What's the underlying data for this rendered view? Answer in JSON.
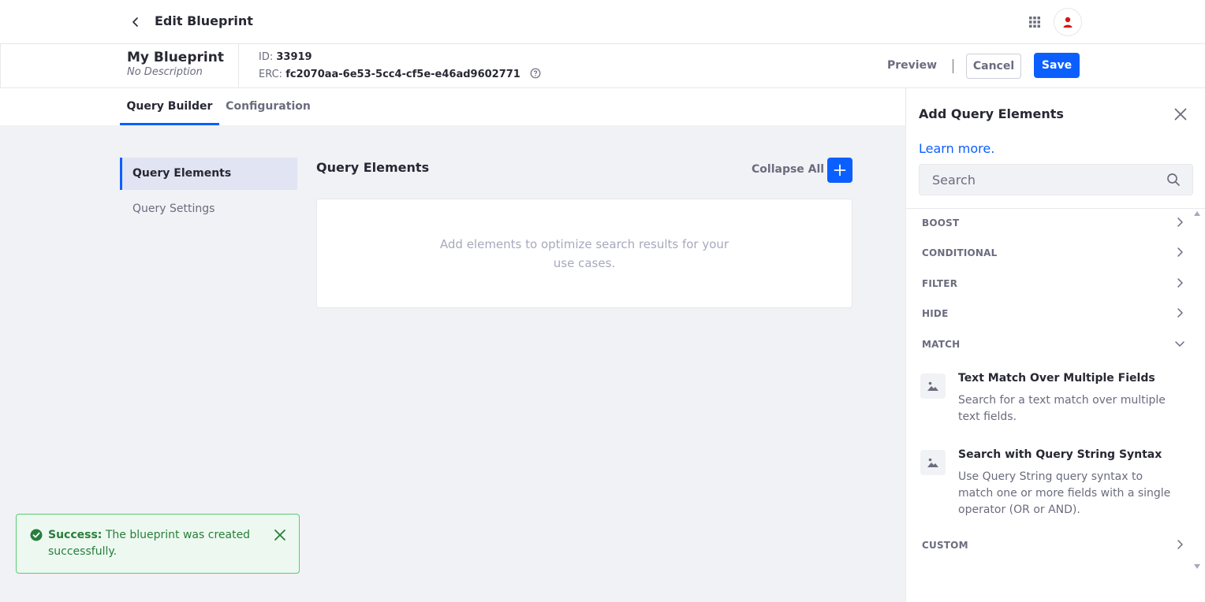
{
  "topbar": {
    "title": "Edit Blueprint"
  },
  "header": {
    "name": "My Blueprint",
    "description": "No Description",
    "id_label": "ID:",
    "id_value": "33919",
    "erc_label": "ERC:",
    "erc_value": "fc2070aa-6e53-5cc4-cf5e-e46ad9602771",
    "preview_label": "Preview",
    "cancel_label": "Cancel",
    "save_label": "Save"
  },
  "tabs": [
    {
      "label": "Query Builder",
      "active": true
    },
    {
      "label": "Configuration",
      "active": false
    }
  ],
  "sidebar": {
    "items": [
      {
        "label": "Query Elements",
        "active": true
      },
      {
        "label": "Query Settings",
        "active": false
      }
    ]
  },
  "main": {
    "title": "Query Elements",
    "collapse_all_label": "Collapse All",
    "empty_text": "Add elements to optimize search results for your use cases."
  },
  "toast": {
    "strong": "Success:",
    "message": "The blueprint was created successfully."
  },
  "panel": {
    "title": "Add Query Elements",
    "learn_more": "Learn more.",
    "search_placeholder": "Search",
    "categories": [
      {
        "label": "BOOST",
        "expanded": false
      },
      {
        "label": "CONDITIONAL",
        "expanded": false
      },
      {
        "label": "FILTER",
        "expanded": false
      },
      {
        "label": "HIDE",
        "expanded": false
      },
      {
        "label": "MATCH",
        "expanded": true
      },
      {
        "label": "CUSTOM",
        "expanded": false
      }
    ],
    "match_elements": [
      {
        "title": "Text Match Over Multiple Fields",
        "description": "Search for a text match over multiple text fields."
      },
      {
        "title": "Search with Query String Syntax",
        "description": "Use Query String query syntax to match one or more fields with a single operator (OR or AND)."
      }
    ]
  },
  "colors": {
    "primary": "#0b5fff",
    "success": "#287d3c",
    "avatar": "#da1414"
  }
}
